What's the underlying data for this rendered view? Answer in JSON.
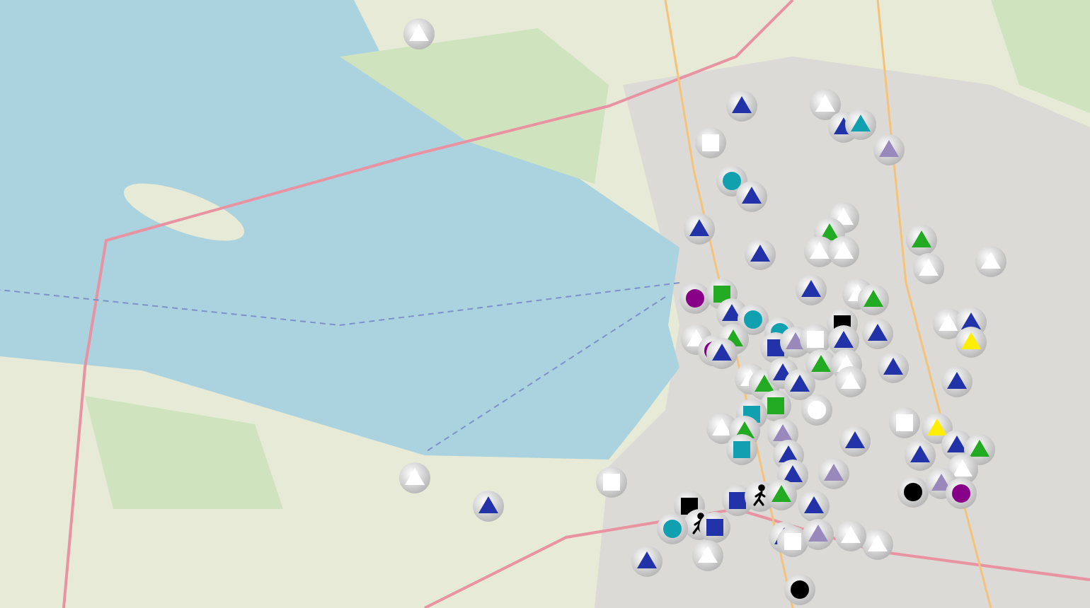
{
  "map": {
    "markers": [
      {
        "kind": "triangle",
        "color": "#ffffff"
      },
      {
        "kind": "triangle",
        "color": "#2233aa"
      },
      {
        "kind": "triangle",
        "color": "#ffffff"
      },
      {
        "kind": "triangle",
        "color": "#2233aa"
      },
      {
        "kind": "triangle",
        "color": "#11a0b0"
      },
      {
        "kind": "triangle",
        "color": "#9988bb"
      },
      {
        "kind": "square",
        "color": "#ffffff"
      },
      {
        "kind": "circle",
        "color": "#11a0b0"
      },
      {
        "kind": "triangle",
        "color": "#2233aa"
      },
      {
        "kind": "triangle",
        "color": "#2233aa"
      },
      {
        "kind": "triangle",
        "color": "#2233aa"
      },
      {
        "kind": "triangle",
        "color": "#ffffff"
      },
      {
        "kind": "triangle",
        "color": "#22aa22"
      },
      {
        "kind": "triangle",
        "color": "#ffffff"
      },
      {
        "kind": "triangle",
        "color": "#ffffff"
      },
      {
        "kind": "triangle",
        "color": "#22aa22"
      },
      {
        "kind": "triangle",
        "color": "#ffffff"
      },
      {
        "kind": "triangle",
        "color": "#ffffff"
      },
      {
        "kind": "circle",
        "color": "#880088"
      },
      {
        "kind": "square",
        "color": "#22aa22"
      },
      {
        "kind": "triangle",
        "color": "#2233aa"
      },
      {
        "kind": "circle",
        "color": "#11a0b0"
      },
      {
        "kind": "triangle",
        "color": "#2233aa"
      },
      {
        "kind": "triangle",
        "color": "#ffffff"
      },
      {
        "kind": "triangle",
        "color": "#22aa22"
      },
      {
        "kind": "triangle",
        "color": "#ffffff"
      },
      {
        "kind": "circle",
        "color": "#880088"
      },
      {
        "kind": "triangle",
        "color": "#22aa22"
      },
      {
        "kind": "triangle",
        "color": "#2233aa"
      },
      {
        "kind": "circle",
        "color": "#11a0b0"
      },
      {
        "kind": "square",
        "color": "#2233aa"
      },
      {
        "kind": "triangle",
        "color": "#9988bb"
      },
      {
        "kind": "square",
        "color": "#ffffff"
      },
      {
        "kind": "square",
        "color": "#000000"
      },
      {
        "kind": "triangle",
        "color": "#2233aa"
      },
      {
        "kind": "triangle",
        "color": "#2233aa"
      },
      {
        "kind": "triangle",
        "color": "#ffffff"
      },
      {
        "kind": "triangle",
        "color": "#2233aa"
      },
      {
        "kind": "triangle",
        "color": "#ffee00"
      },
      {
        "kind": "triangle",
        "color": "#22aa22"
      },
      {
        "kind": "triangle",
        "color": "#ffffff"
      },
      {
        "kind": "triangle",
        "color": "#2233aa"
      },
      {
        "kind": "triangle",
        "color": "#ffffff"
      },
      {
        "kind": "triangle",
        "color": "#22aa22"
      },
      {
        "kind": "triangle",
        "color": "#2233aa"
      },
      {
        "kind": "triangle",
        "color": "#2233aa"
      },
      {
        "kind": "triangle",
        "color": "#ffffff"
      },
      {
        "kind": "triangle",
        "color": "#2233aa"
      },
      {
        "kind": "circle",
        "color": "#ffffff"
      },
      {
        "kind": "square",
        "color": "#22aa22"
      },
      {
        "kind": "square",
        "color": "#11a0b0"
      },
      {
        "kind": "triangle",
        "color": "#ffffff"
      },
      {
        "kind": "triangle",
        "color": "#22aa22"
      },
      {
        "kind": "triangle",
        "color": "#9988bb"
      },
      {
        "kind": "square",
        "color": "#11a0b0"
      },
      {
        "kind": "square",
        "color": "#ffffff"
      },
      {
        "kind": "triangle",
        "color": "#ffee00"
      },
      {
        "kind": "triangle",
        "color": "#2233aa"
      },
      {
        "kind": "triangle",
        "color": "#2233aa"
      },
      {
        "kind": "triangle",
        "color": "#22aa22"
      },
      {
        "kind": "triangle",
        "color": "#2233aa"
      },
      {
        "kind": "triangle",
        "color": "#ffffff"
      },
      {
        "kind": "triangle",
        "color": "#2233aa"
      },
      {
        "kind": "triangle",
        "color": "#2233aa"
      },
      {
        "kind": "triangle",
        "color": "#9988bb"
      },
      {
        "kind": "square",
        "color": "#ffffff"
      },
      {
        "kind": "circle",
        "color": "#000000"
      },
      {
        "kind": "triangle",
        "color": "#9988bb"
      },
      {
        "kind": "circle",
        "color": "#880088"
      },
      {
        "kind": "square",
        "color": "#000000"
      },
      {
        "kind": "square",
        "color": "#2233aa"
      },
      {
        "kind": "walker",
        "color": "#000000"
      },
      {
        "kind": "triangle",
        "color": "#22aa22"
      },
      {
        "kind": "triangle",
        "color": "#2233aa"
      },
      {
        "kind": "walker",
        "color": "#000000"
      },
      {
        "kind": "square",
        "color": "#2233aa"
      },
      {
        "kind": "circle",
        "color": "#11a0b0"
      },
      {
        "kind": "triangle",
        "color": "#2233aa"
      },
      {
        "kind": "square",
        "color": "#ffffff"
      },
      {
        "kind": "triangle",
        "color": "#9988bb"
      },
      {
        "kind": "triangle",
        "color": "#ffffff"
      },
      {
        "kind": "triangle",
        "color": "#ffffff"
      },
      {
        "kind": "triangle",
        "color": "#2233aa"
      },
      {
        "kind": "circle",
        "color": "#000000"
      },
      {
        "kind": "triangle",
        "color": "#ffffff"
      },
      {
        "kind": "triangle",
        "color": "#2233aa"
      },
      {
        "kind": "triangle",
        "color": "#ffffff"
      }
    ]
  }
}
